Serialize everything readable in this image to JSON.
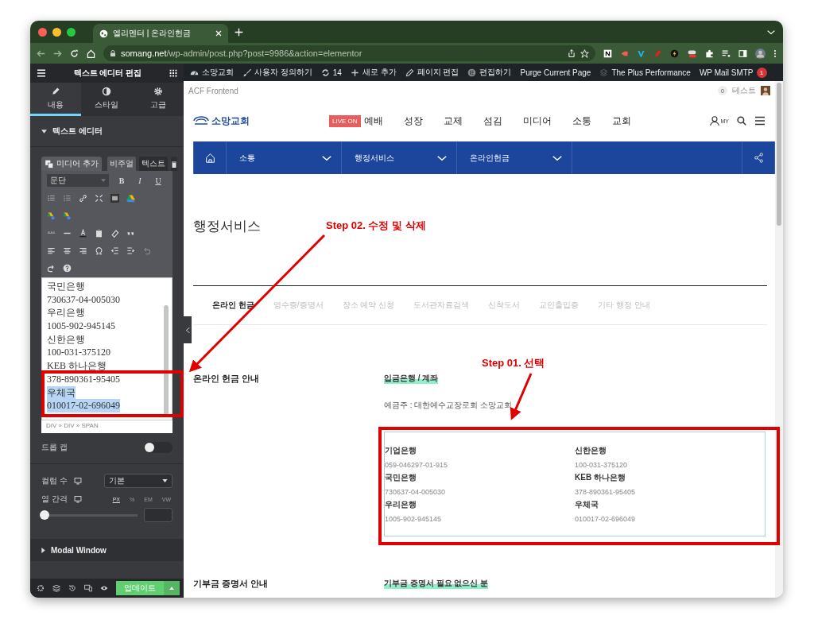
{
  "browser": {
    "tab_title": "엘리멘터 | 온라인헌금",
    "url_host": "somang.net",
    "url_path": "/wp-admin/post.php?post=9986&action=elementor"
  },
  "editor_panel": {
    "title": "텍스트 에디터 편집",
    "tabs": [
      {
        "label": "내용",
        "kind": "pencil",
        "selected": true
      },
      {
        "label": "스타일",
        "kind": "contrast",
        "selected": false
      },
      {
        "label": "고급",
        "kind": "gear",
        "selected": false
      }
    ],
    "section": "텍스트 에디터",
    "media_button": "미디어 추가",
    "mode_tabs": [
      {
        "label": "비주얼",
        "selected": true
      },
      {
        "label": "텍스트",
        "selected": false
      }
    ],
    "format": "문단",
    "format_buttons": [
      "B",
      "I",
      "U"
    ],
    "content_lines": [
      {
        "text": "국민은행",
        "selected": false
      },
      {
        "text": "730637-04-005030",
        "selected": false
      },
      {
        "text": "우리은행",
        "selected": false
      },
      {
        "text": "1005-902-945145",
        "selected": false
      },
      {
        "text": "신한은행",
        "selected": false
      },
      {
        "text": "100-031-375120",
        "selected": false
      },
      {
        "text": "KEB 하나은행",
        "selected": false
      },
      {
        "text": "378-890361-95405",
        "selected": false
      },
      {
        "text": "우체국",
        "selected": true
      },
      {
        "text": "010017-02-696049",
        "selected": true
      }
    ],
    "path": "DIV » DIV » SPAN",
    "drop_cap": {
      "label": "드롭 캡",
      "on": false
    },
    "columns": {
      "label": "컬럼 수",
      "value": "기본"
    },
    "gap": {
      "label": "열 간격",
      "units": [
        {
          "label": "PX",
          "selected": true
        },
        {
          "label": "%",
          "selected": false
        },
        {
          "label": "EM",
          "selected": false
        },
        {
          "label": "VW",
          "selected": false
        }
      ],
      "level": 0
    },
    "modal_section": "Modal Window",
    "update_button": "업데이트"
  },
  "admin_bar": {
    "items": [
      {
        "kind": "dashboard",
        "label": "소망교회"
      },
      {
        "kind": "brush",
        "label": "사용자 정의하기"
      },
      {
        "kind": "refresh",
        "label": "14"
      },
      {
        "kind": "plus",
        "label": "새로 추가"
      },
      {
        "kind": "pencil",
        "label": "페이지 편집"
      },
      {
        "kind": "elementor",
        "label": "편집하기"
      },
      {
        "kind": "none",
        "label": "Purge Current Page"
      },
      {
        "kind": "stack",
        "label": "The Plus Performance"
      },
      {
        "kind": "none",
        "label": "WP Mail SMTP"
      }
    ],
    "badge": "1"
  },
  "site": {
    "toolbar": {
      "plugin": "ACF Frontend",
      "count": "0",
      "user": "테스트"
    },
    "logo": "소망교회",
    "live": "LIVE ON",
    "nav": [
      "예배",
      "성장",
      "교제",
      "섬김",
      "미디어",
      "소통",
      "교회"
    ],
    "my": "MY",
    "breadcrumb": [
      "소통",
      "행정서비스",
      "온라인헌금"
    ],
    "page_title": "행정서비스",
    "tabs": [
      {
        "label": "온라인 헌금",
        "selected": true
      },
      {
        "label": "영수증/증명서",
        "selected": false
      },
      {
        "label": "장소 예약 신청",
        "selected": false
      },
      {
        "label": "도서관자료검색",
        "selected": false
      },
      {
        "label": "신착도서",
        "selected": false
      },
      {
        "label": "교인출입증",
        "selected": false
      },
      {
        "label": "기타 행정 안내",
        "selected": false
      }
    ],
    "sections": [
      {
        "heading": "온라인 헌금 안내",
        "label": "입금은행 / 계좌",
        "holder": "예금주 : 대한예수교장로회 소망교회",
        "accounts": [
          {
            "bank": "기업은행",
            "number": "059-046297-01-915"
          },
          {
            "bank": "신한은행",
            "number": "100-031-375120"
          },
          {
            "bank": "국민은행",
            "number": "730637-04-005030"
          },
          {
            "bank": "KEB 하나은행",
            "number": "378-890361-95405"
          },
          {
            "bank": "우리은행",
            "number": "1005-902-945145"
          },
          {
            "bank": "우체국",
            "number": "010017-02-696049"
          }
        ]
      },
      {
        "heading": "기부금 증명서 안내",
        "label": "기부금 증명서 필요 없으신 분"
      }
    ]
  },
  "annotations": [
    {
      "text": "Step 02. 수정 및 삭제"
    },
    {
      "text": "Step 01. 선택"
    }
  ]
}
